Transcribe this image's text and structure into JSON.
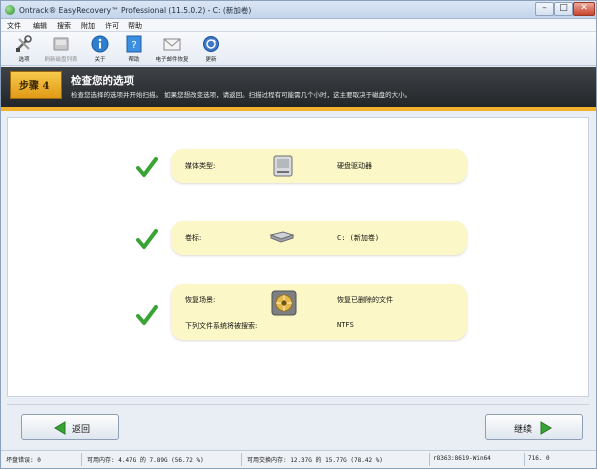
{
  "window": {
    "title": "Ontrack® EasyRecovery™ Professional (11.5.0.2) - C: (新加卷)",
    "controls": {
      "minimize": "–",
      "maximize": "□",
      "close": "✕"
    }
  },
  "menu": {
    "items": [
      "文件",
      "编辑",
      "搜索",
      "附加",
      "许可",
      "帮助"
    ]
  },
  "toolbar": {
    "items": [
      {
        "label": "选项",
        "icon": "tools-icon",
        "enabled": true
      },
      {
        "label": "刷新磁盘列表",
        "icon": "refresh-disk-icon",
        "enabled": false
      },
      {
        "label": "关于",
        "icon": "info-icon",
        "enabled": true
      },
      {
        "label": "帮助",
        "icon": "help-icon",
        "enabled": true
      },
      {
        "label": "电子邮件恢复",
        "icon": "email-icon",
        "enabled": true
      },
      {
        "label": "更新",
        "icon": "update-icon",
        "enabled": true
      }
    ]
  },
  "step": {
    "badge": "步骤 4",
    "title": "检查您的选项",
    "description": "检查您选择的选项并开始扫描。 如果您想改变选项，请返回。扫描过程有可能需几个小时，这主要取决于磁盘的大小。"
  },
  "summary": {
    "media": {
      "label": "媒体类型:",
      "value": "硬盘驱动器"
    },
    "volume": {
      "label": "卷标:",
      "value": "C: (新加卷)"
    },
    "scenario": {
      "label": "恢复场景:",
      "value": "恢复已删除的文件"
    },
    "filesystem": {
      "label": "下列文件系统将被搜索:",
      "value": "NTFS"
    }
  },
  "nav": {
    "back": "返回",
    "next": "继续"
  },
  "status": {
    "bad_sectors": "坏盘错误: 0",
    "memory": "可用内存: 4.47G 的 7.89G (56.72 %)",
    "swap": "可用交换内存: 12.37G 的 15.77G (78.42 %)",
    "build": "r8363:8619-Win64",
    "code": "716. 0"
  },
  "colors": {
    "accent": "#f0b12c",
    "card": "#fbf7c6",
    "check": "#3aa336"
  }
}
